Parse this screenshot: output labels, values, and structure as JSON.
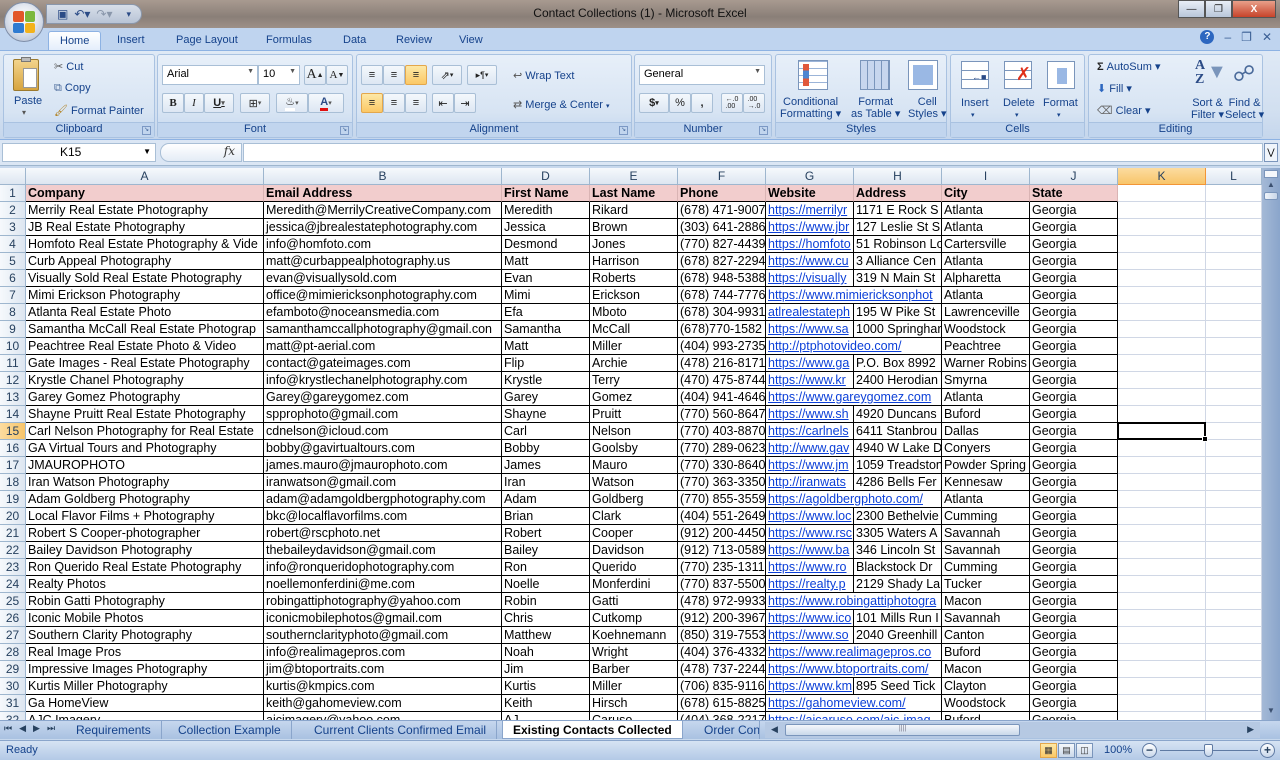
{
  "window": {
    "title": "Contact Collections (1) - Microsoft Excel",
    "minimize": "–",
    "restore": "❐",
    "close": "X"
  },
  "qat": {
    "save": "💾",
    "undo": "↶",
    "redo": "↷",
    "customize": "▾"
  },
  "ribbon_tabs": [
    "Home",
    "Insert",
    "Page Layout",
    "Formulas",
    "Data",
    "Review",
    "View"
  ],
  "active_tab": "Home",
  "ribbon": {
    "clipboard": {
      "label": "Clipboard",
      "paste": "Paste",
      "cut": "Cut",
      "copy": "Copy",
      "format_painter": "Format Painter"
    },
    "font": {
      "label": "Font",
      "font_name": "Arial",
      "font_size": "10",
      "bold": "B",
      "italic": "I",
      "underline": "U",
      "grow": "A",
      "shrink": "A"
    },
    "alignment": {
      "label": "Alignment",
      "wrap_text": "Wrap Text",
      "merge_center": "Merge & Center"
    },
    "number": {
      "label": "Number",
      "format": "General",
      "currency": "$",
      "percent": "%",
      "comma": ",",
      "inc_decimal": "←.0 .00",
      "dec_decimal": ".00 →.0"
    },
    "styles": {
      "label": "Styles",
      "conditional_formatting": [
        "Conditional",
        "Formatting ▾"
      ],
      "format_as_table": [
        "Format",
        "as Table ▾"
      ],
      "cell_styles": [
        "Cell",
        "Styles ▾"
      ]
    },
    "cells": {
      "label": "Cells",
      "insert": "Insert",
      "delete": "Delete",
      "format": "Format"
    },
    "editing": {
      "label": "Editing",
      "autosum": "AutoSum ▾",
      "fill": "Fill ▾",
      "clear": "Clear ▾",
      "sort_filter": [
        "Sort &",
        "Filter ▾"
      ],
      "find_select": [
        "Find &",
        "Select ▾"
      ]
    }
  },
  "formula_bar": {
    "name_box": "K15",
    "fx": "fx",
    "formula": ""
  },
  "columns": [
    "A",
    "B",
    "D",
    "E",
    "F",
    "G",
    "H",
    "I",
    "J",
    "K",
    "L"
  ],
  "selected_column": "K",
  "selected_row": "15",
  "header_row": [
    "Company",
    "Email Address",
    "First Name",
    "Last Name",
    "Phone",
    "Website",
    "Address",
    "City",
    "State"
  ],
  "rows": [
    [
      " Merrily Real Estate Photography",
      "Meredith@MerrilyCreativeCompany.com",
      "Meredith",
      "Rikard",
      "(678) 471-9007",
      "https://merrilyr",
      "1171 E Rock S",
      "Atlanta",
      "Georgia"
    ],
    [
      "JB Real Estate Photography",
      "jessica@jbrealestatephotography.com",
      "Jessica",
      "Brown",
      "(303) 641-2886",
      "https://www.jbr",
      "127 Leslie St S",
      "Atlanta",
      "Georgia"
    ],
    [
      "Homfoto Real Estate Photography & Vide",
      "info@homfoto.com",
      "Desmond",
      "Jones",
      "(770) 827-4439",
      "https://homfoto",
      "51 Robinson Lo",
      "Cartersville",
      "Georgia"
    ],
    [
      "Curb Appeal Photography",
      "matt@curbappealphotography.us",
      "Matt",
      "Harrison",
      "(678) 827-2294",
      "https://www.cu",
      "3 Alliance Cen",
      "Atlanta",
      "Georgia"
    ],
    [
      "Visually Sold Real Estate Photography",
      "evan@visuallysold.com",
      "Evan",
      "Roberts",
      "(678) 948-5388",
      "https://visually",
      "319 N Main St",
      "Alpharetta",
      "Georgia"
    ],
    [
      "Mimi Erickson Photography",
      "office@mimiericksonphotography.com",
      "Mimi",
      "Erickson",
      "(678) 744-7776",
      "https://www.mimiericksonphot",
      "",
      "Atlanta",
      "Georgia"
    ],
    [
      "Atlanta Real Estate Photo",
      "efamboto@noceansmedia.com",
      "Efa",
      "Mboto",
      "(678) 304-9931",
      "atlrealestateph",
      "195 W Pike St",
      "Lawrenceville",
      "Georgia"
    ],
    [
      "Samantha McCall Real Estate Photograp",
      "samanthamccallphotography@gmail.con",
      "Samantha",
      "McCall",
      "(678)770-1582",
      "https://www.sa",
      "1000 Springhar",
      "Woodstock",
      "Georgia"
    ],
    [
      "Peachtree Real Estate Photo & Video",
      "matt@pt-aerial.com",
      "Matt",
      "Miller",
      "(404) 993-2735",
      "http://ptphotovideo.com/",
      "",
      "Peachtree",
      "Georgia"
    ],
    [
      "Gate Images - Real Estate Photography",
      "contact@gateimages.com",
      "Flip",
      "Archie",
      "(478) 216-8171",
      "https://www.ga",
      "P.O. Box 8992",
      "Warner Robins",
      "Georgia"
    ],
    [
      "Krystle Chanel Photography",
      "info@krystlechanelphotography.com",
      "Krystle",
      "Terry",
      "(470) 475-8744",
      "https://www.kr",
      "2400 Herodian",
      "Smyrna",
      "Georgia"
    ],
    [
      "Garey Gomez Photography",
      "Garey@gareygomez.com",
      "Garey",
      "Gomez",
      "(404) 941-4646",
      "https://www.gareygomez.com",
      "",
      "Atlanta",
      "Georgia"
    ],
    [
      "Shayne Pruitt Real Estate Photography",
      "spprophoto@gmail.com",
      "Shayne",
      "Pruitt",
      "(770) 560-8647",
      "https://www.sh",
      "4920 Duncans",
      "Buford",
      "Georgia"
    ],
    [
      "Carl Nelson Photography for Real Estate",
      "cdnelson@icloud.com",
      "Carl",
      "Nelson",
      "(770) 403-8870",
      "https://carlnels",
      "6411 Stanbrou",
      "Dallas",
      "Georgia"
    ],
    [
      "GA Virtual Tours and Photography",
      "bobby@gavirtualtours.com",
      "Bobby",
      "Goolsby",
      "(770) 289-0623",
      "http://www.gav",
      "4940 W Lake D",
      "Conyers",
      "Georgia"
    ],
    [
      "JMAUROPHOTO",
      "james.mauro@jmaurophoto.com",
      "James",
      "Mauro",
      "(770) 330-8640",
      "https://www.jm",
      "1059 Treadston",
      "Powder Spring",
      "Georgia"
    ],
    [
      "Iran Watson Photography",
      "iranwatson@gmail.com",
      "Iran",
      "Watson",
      "(770) 363-3350",
      "http://iranwats",
      "4286 Bells Fer",
      "Kennesaw",
      "Georgia"
    ],
    [
      "Adam Goldberg Photography",
      "adam@adamgoldbergphotography.com",
      "Adam",
      "Goldberg",
      "(770) 855-3559",
      "https://agoldbergphoto.com/",
      "",
      "Atlanta",
      "Georgia"
    ],
    [
      "Local Flavor Films + Photography",
      "bkc@localflavorfilms.com",
      "Brian",
      "Clark",
      "(404) 551-2649",
      "https://www.loc",
      "2300 Bethelvie",
      "Cumming",
      "Georgia"
    ],
    [
      "Robert S Cooper-photographer",
      "robert@rscphoto.net",
      "Robert",
      "Cooper",
      "(912) 200-4450",
      "https://www.rsc",
      "3305 Waters A",
      "Savannah",
      "Georgia"
    ],
    [
      "Bailey Davidson Photography",
      "thebaileydavidson@gmail.com",
      "Bailey",
      "Davidson",
      "(912) 713-0589",
      "https://www.ba",
      "346 Lincoln St",
      "Savannah",
      "Georgia"
    ],
    [
      "Ron Querido Real Estate Photography",
      "info@ronqueridophotography.com",
      "Ron",
      "Querido",
      "(770) 235-1311",
      "https://www.ro",
      "Blackstock Dr",
      "Cumming",
      "Georgia"
    ],
    [
      "Realty Photos",
      "noellemonferdini@me.com",
      "Noelle",
      "Monferdini",
      "(770) 837-5500",
      "https://realty.p",
      "2129 Shady La",
      "Tucker",
      "Georgia"
    ],
    [
      "Robin Gatti Photography",
      "robingattiphotography@yahoo.com",
      "Robin",
      "Gatti",
      "(478) 972-9933",
      "https://www.robingattiphotogra",
      "",
      "Macon",
      "Georgia"
    ],
    [
      "Iconic Mobile Photos",
      "iconicmobilephotos@gmail.com",
      "Chris",
      "Cutkomp",
      "(912) 200-3967",
      "https://www.ico",
      "101 Mills Run I",
      "Savannah",
      "Georgia"
    ],
    [
      "Southern Clarity Photography",
      "southernclarityphoto@gmail.com",
      "Matthew",
      "Koehnemann",
      "(850) 319-7553",
      "https://www.so",
      "2040 Greenhill",
      "Canton",
      "Georgia"
    ],
    [
      "Real Image Pros",
      "info@realimagepros.com",
      "Noah",
      "Wright",
      "(404) 376-4332",
      "https://www.realimagepros.co",
      "",
      "Buford",
      "Georgia"
    ],
    [
      "Impressive Images Photography",
      "jim@btoportraits.com",
      "Jim",
      "Barber",
      "(478) 737-2244",
      "https://www.btoportraits.com/",
      "",
      "Macon",
      "Georgia"
    ],
    [
      "Kurtis Miller Photography",
      "kurtis@kmpics.com",
      "Kurtis",
      "Miller",
      "(706) 835-9116",
      "https://www.km",
      "895 Seed Tick",
      "Clayton",
      "Georgia"
    ],
    [
      "Ga HomeView",
      "keith@gahomeview.com",
      "Keith",
      "Hirsch",
      "(678) 615-8825",
      "https://gahomeview.com/",
      "",
      "Woodstock",
      "Georgia"
    ],
    [
      "AJC Imagery",
      "ajcimagery@yahoo.com",
      "AJ",
      "Caruso",
      "(404) 368-2217",
      "https://ajcaruso.com/ajc-imag",
      "",
      "Buford",
      "Georgia"
    ]
  ],
  "sheet_tabs": [
    "Requirements",
    "Collection Example",
    "Current Clients Confirmed Email",
    "Existing Contacts Collected",
    "Order Con"
  ],
  "active_sheet": "Existing Contacts Collected",
  "status": {
    "text": "Ready",
    "zoom": "100%",
    "zoom_fraction": 0.5
  }
}
